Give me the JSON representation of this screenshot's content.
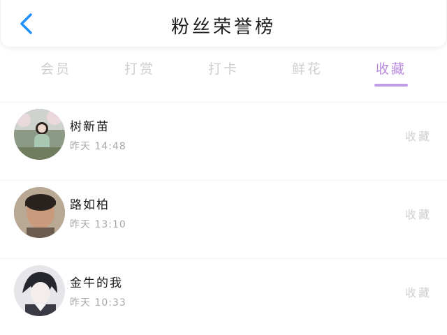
{
  "header": {
    "title": "粉丝荣誉榜",
    "back_icon": "chevron-left-icon",
    "accent": "#1e90ff"
  },
  "tabs": [
    {
      "label": "会员",
      "active": false
    },
    {
      "label": "打赏",
      "active": false
    },
    {
      "label": "打卡",
      "active": false
    },
    {
      "label": "鲜花",
      "active": false
    },
    {
      "label": "收藏",
      "active": true
    }
  ],
  "colors": {
    "active_tab": "#b98be0",
    "inactive_tab": "#cfcfcf",
    "underline": "#c39ce6"
  },
  "fans": [
    {
      "name": "树新苗",
      "time": "昨天 14:48",
      "action": "收藏"
    },
    {
      "name": "路如柏",
      "time": "昨天 13:10",
      "action": "收藏"
    },
    {
      "name": "金牛的我",
      "time": "昨天 10:33",
      "action": "收藏"
    }
  ]
}
